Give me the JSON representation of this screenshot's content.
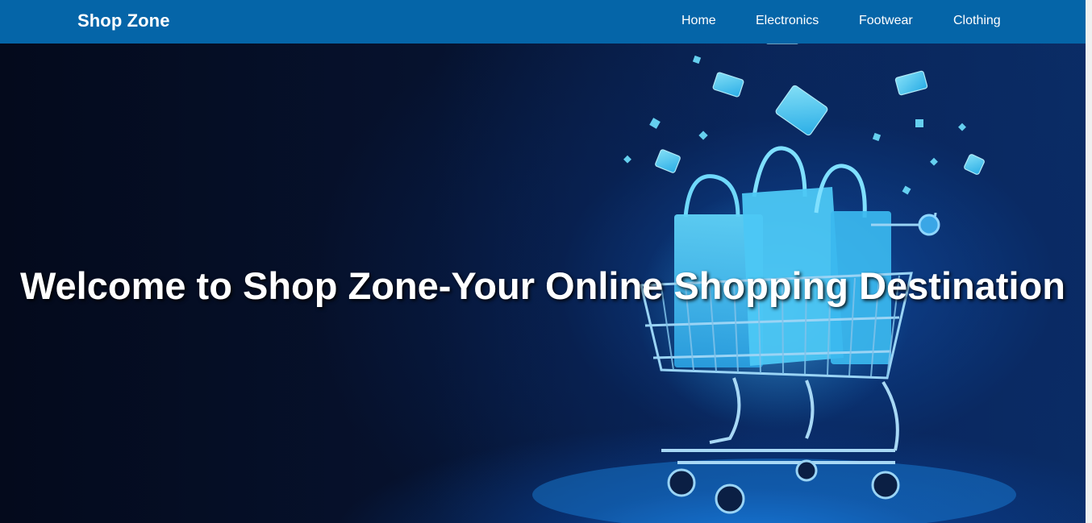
{
  "nav": {
    "brand": "Shop Zone",
    "links": [
      {
        "label": "Home"
      },
      {
        "label": "Electronics"
      },
      {
        "label": "Footwear"
      },
      {
        "label": "Clothing"
      }
    ]
  },
  "hero": {
    "title": "Welcome to Shop Zone-Your Online Shopping Destination",
    "image": "shopping-cart-with-bags-and-credit-cards-illustration"
  },
  "colors": {
    "navbar": "#0565a8",
    "hero_background": "#050d22",
    "text": "#ffffff",
    "accent_glow": "#36c6f4"
  }
}
